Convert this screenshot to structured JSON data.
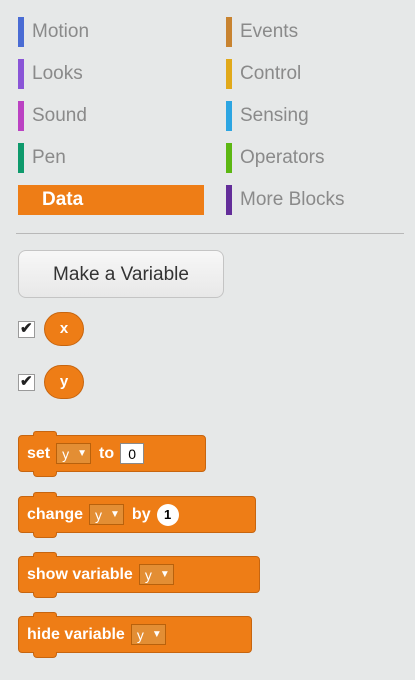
{
  "categories": [
    {
      "label": "Motion",
      "color": "#4a6cd4",
      "selected": false
    },
    {
      "label": "Looks",
      "color": "#8a55d7",
      "selected": false
    },
    {
      "label": "Sound",
      "color": "#bb42c3",
      "selected": false
    },
    {
      "label": "Pen",
      "color": "#0e9a6c",
      "selected": false
    },
    {
      "label": "Data",
      "color": "#ee7d16",
      "selected": true
    },
    {
      "label": "Events",
      "color": "#c88330",
      "selected": false
    },
    {
      "label": "Control",
      "color": "#e1a91a",
      "selected": false
    },
    {
      "label": "Sensing",
      "color": "#2ca5e2",
      "selected": false
    },
    {
      "label": "Operators",
      "color": "#5cb712",
      "selected": false
    },
    {
      "label": "More Blocks",
      "color": "#632d99",
      "selected": false
    }
  ],
  "make_variable_label": "Make a Variable",
  "variables": [
    {
      "name": "x",
      "checked": true
    },
    {
      "name": "y",
      "checked": true
    }
  ],
  "blocks": {
    "set": {
      "label": "set",
      "var": "y",
      "to_label": "to",
      "value": "0"
    },
    "change": {
      "label": "change",
      "var": "y",
      "by_label": "by",
      "value": "1"
    },
    "show": {
      "label": "show variable",
      "var": "y"
    },
    "hide": {
      "label": "hide variable",
      "var": "y"
    }
  },
  "colors": {
    "data_block": "#ee7d16",
    "selected_category": "#ee7d16"
  },
  "icons": {
    "dropdown": "triangle-down",
    "checkbox": "check-mark"
  }
}
